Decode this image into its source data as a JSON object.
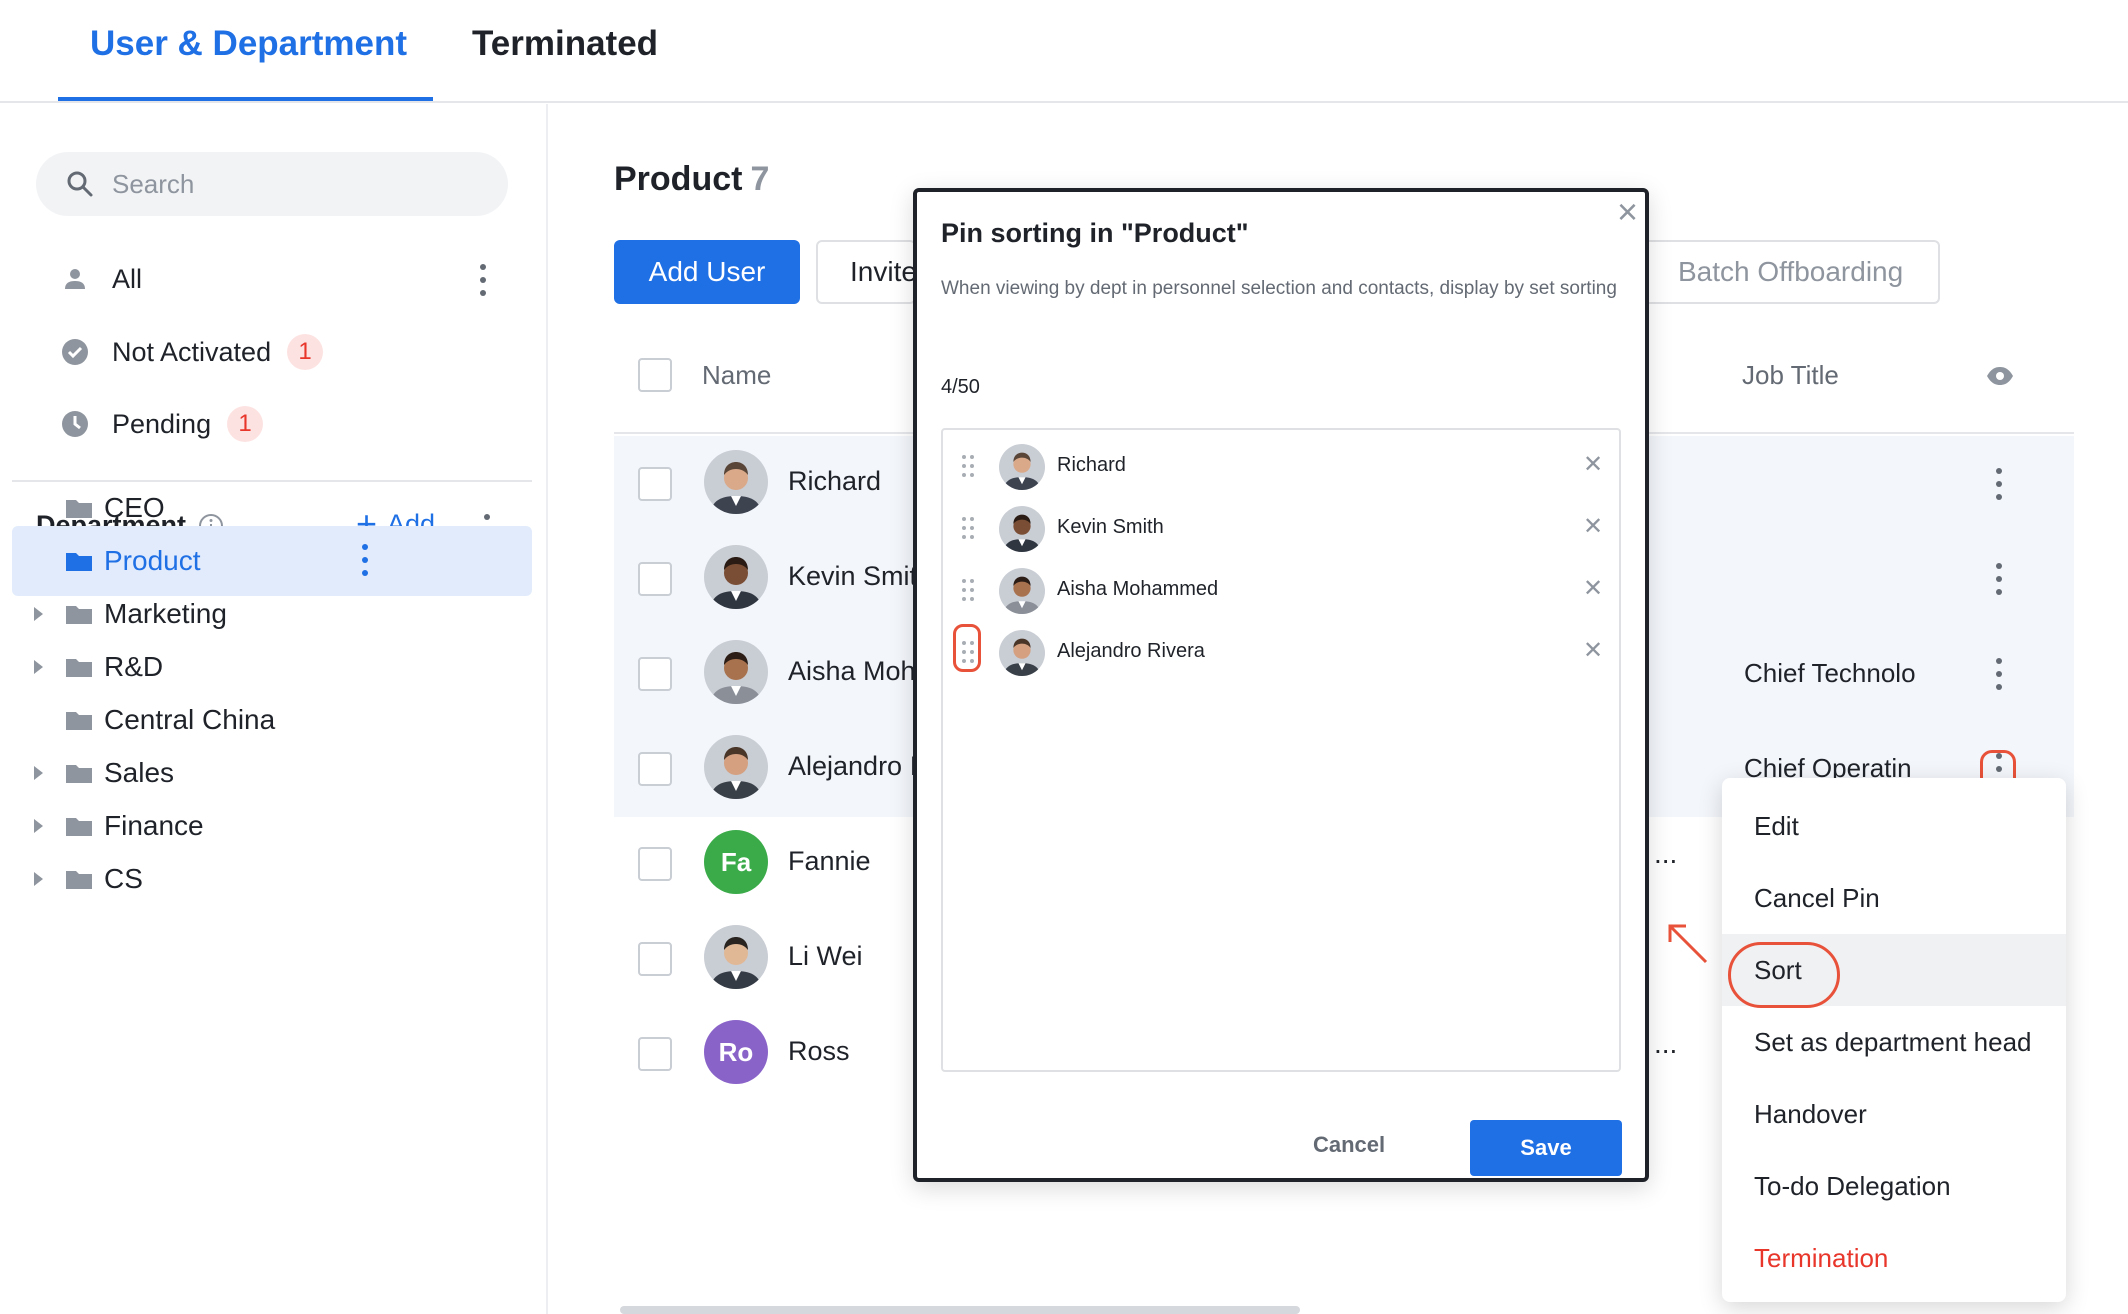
{
  "tabs": [
    {
      "label": "User & Department",
      "active": true
    },
    {
      "label": "Terminated",
      "active": false
    }
  ],
  "sidebar": {
    "search_placeholder": "Search",
    "filters": [
      {
        "label": "All",
        "icon": "user-icon"
      },
      {
        "label": "Not Activated",
        "icon": "check-circle-icon",
        "badge": "1"
      },
      {
        "label": "Pending",
        "icon": "clock-icon",
        "badge": "1"
      }
    ],
    "department_title": "Department",
    "add_label": "Add",
    "departments": [
      {
        "label": "CEO",
        "expandable": false,
        "selected": false
      },
      {
        "label": "Product",
        "expandable": false,
        "selected": true
      },
      {
        "label": "Marketing",
        "expandable": true,
        "selected": false
      },
      {
        "label": "R&D",
        "expandable": true,
        "selected": false
      },
      {
        "label": "Central China",
        "expandable": false,
        "selected": false
      },
      {
        "label": "Sales",
        "expandable": true,
        "selected": false
      },
      {
        "label": "Finance",
        "expandable": true,
        "selected": false
      },
      {
        "label": "CS",
        "expandable": true,
        "selected": false
      }
    ]
  },
  "main": {
    "title": "Product",
    "count": "7",
    "add_user_label": "Add User",
    "invite_label": "Invite",
    "batch_offboarding_label": "Batch Offboarding",
    "columns": {
      "name": "Name",
      "job_title": "Job Title"
    },
    "rows": [
      {
        "name": "Richard",
        "job": "",
        "avatar": "photo",
        "pinned": true
      },
      {
        "name": "Kevin Smit",
        "job": "",
        "avatar": "photo",
        "pinned": true
      },
      {
        "name": "Aisha Moh",
        "job": "Chief Technolo",
        "avatar": "photo",
        "pinned": true
      },
      {
        "name": "Alejandro I",
        "job": "Chief Operatin",
        "avatar": "photo",
        "pinned": true
      },
      {
        "name": "Fannie",
        "job": "",
        "avatar": "Fa",
        "avatar_color": "#3bab4a",
        "pinned": false,
        "ellipsis": "..."
      },
      {
        "name": "Li Wei",
        "job": "",
        "avatar": "photo",
        "pinned": false
      },
      {
        "name": "Ross",
        "job": "",
        "avatar": "Ro",
        "avatar_color": "#8a63c9",
        "pinned": false,
        "ellipsis": "..."
      }
    ]
  },
  "modal": {
    "title": "Pin sorting in \"Product\"",
    "description": "When viewing by dept in personnel selection and contacts, display by set sorting",
    "count": "4/50",
    "items": [
      "Richard",
      "Kevin Smith",
      "Aisha Mohammed",
      "Alejandro Rivera"
    ],
    "cancel_label": "Cancel",
    "save_label": "Save"
  },
  "context_menu": {
    "items": [
      "Edit",
      "Cancel Pin",
      "Sort",
      "Set as department head",
      "Handover",
      "To-do Delegation",
      "Termination"
    ]
  },
  "colors": {
    "accent": "#1f6fe5",
    "danger": "#e8362b",
    "annotation": "#e8523a"
  }
}
